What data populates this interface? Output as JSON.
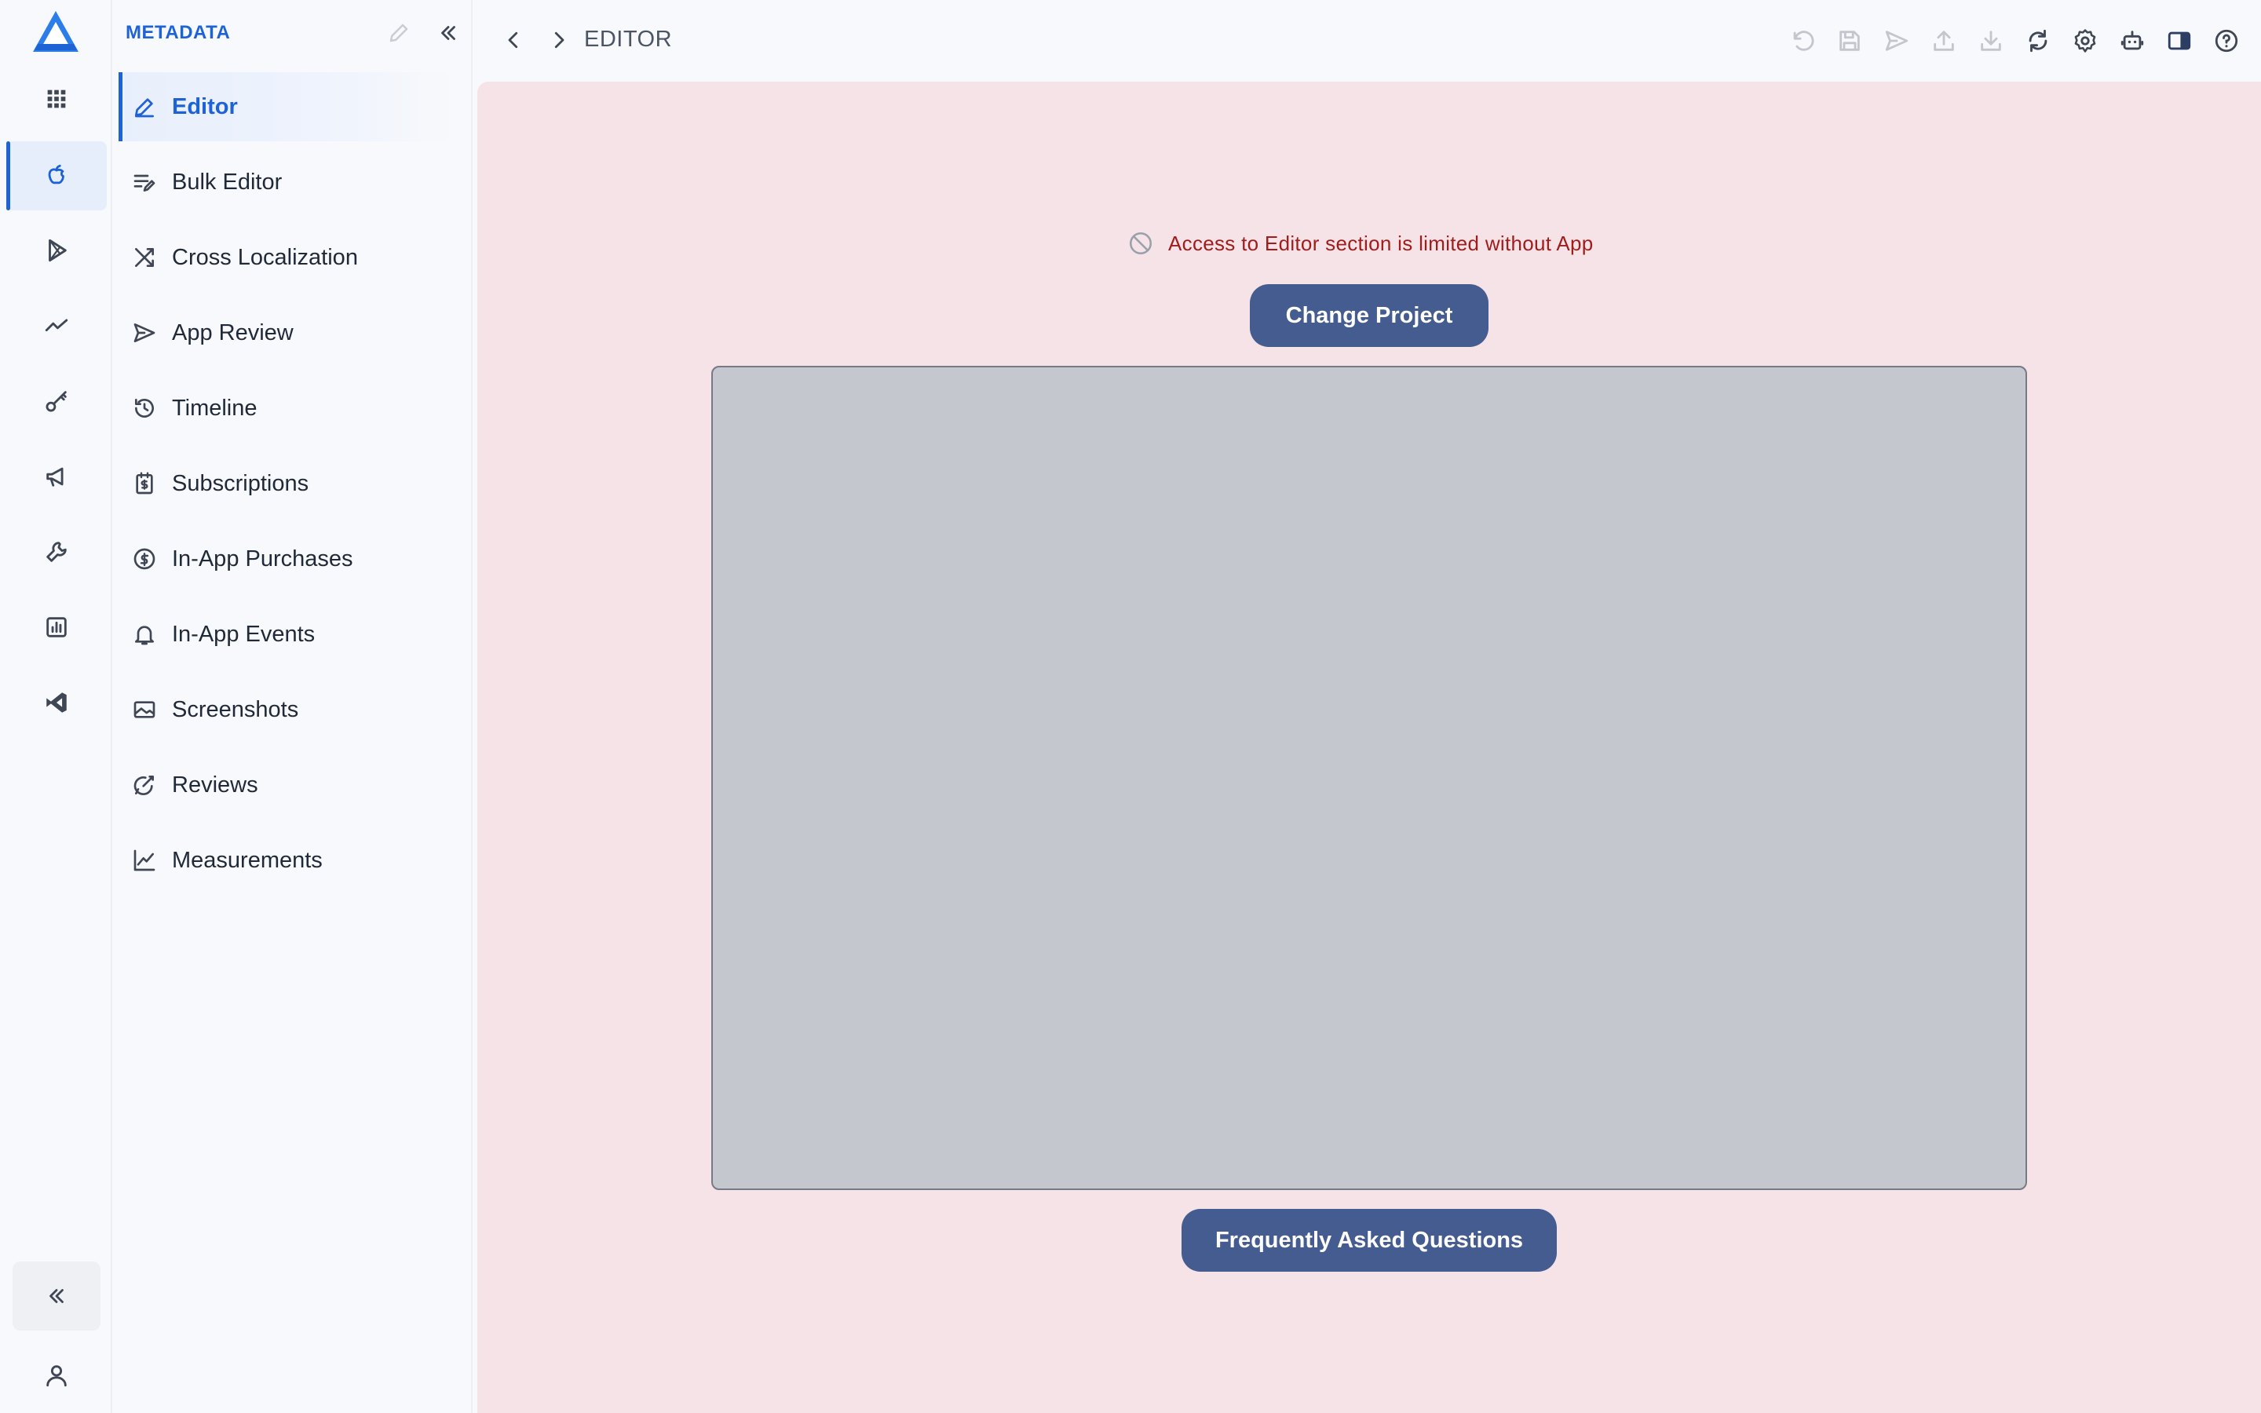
{
  "app": {
    "logo_icon": "app-logo-triangle",
    "accent_color": "#1e63d6"
  },
  "rail": {
    "items": [
      {
        "icon": "apps-grid-icon"
      },
      {
        "icon": "apple-icon",
        "active": true
      },
      {
        "icon": "play-store-icon"
      },
      {
        "icon": "trend-icon"
      },
      {
        "icon": "key-icon"
      },
      {
        "icon": "megaphone-icon"
      },
      {
        "icon": "tools-icon"
      },
      {
        "icon": "bar-chart-icon"
      },
      {
        "icon": "vscode-icon"
      }
    ],
    "collapse_icon": "double-chevron-left-icon",
    "user_icon": "user-icon"
  },
  "sidebar": {
    "title": "METADATA",
    "items": [
      {
        "label": "Editor",
        "icon": "pencil-icon",
        "active": true
      },
      {
        "label": "Bulk Editor",
        "icon": "bulk-edit-icon"
      },
      {
        "label": "Cross Localization",
        "icon": "shuffle-icon"
      },
      {
        "label": "App Review",
        "icon": "send-icon"
      },
      {
        "label": "Timeline",
        "icon": "history-icon"
      },
      {
        "label": "Subscriptions",
        "icon": "subscription-icon"
      },
      {
        "label": "In-App Purchases",
        "icon": "dollar-circle-icon"
      },
      {
        "label": "In-App Events",
        "icon": "bell-icon"
      },
      {
        "label": "Screenshots",
        "icon": "image-icon"
      },
      {
        "label": "Reviews",
        "icon": "review-icon"
      },
      {
        "label": "Measurements",
        "icon": "line-chart-icon"
      }
    ]
  },
  "topbar": {
    "title": "EDITOR",
    "tools": [
      "undo-icon",
      "save-icon",
      "send-icon",
      "upload-icon",
      "download-icon",
      "refresh-icon",
      "settings-icon",
      "robot-icon",
      "panel-toggle-icon",
      "help-icon"
    ]
  },
  "main": {
    "notice": "Access to Editor section is limited without App",
    "change_project_label": "Change Project",
    "faq_label": "Frequently Asked Questions",
    "background_color": "#f5e3e7",
    "button_color": "#445c8f",
    "notice_color": "#a11c1c"
  }
}
